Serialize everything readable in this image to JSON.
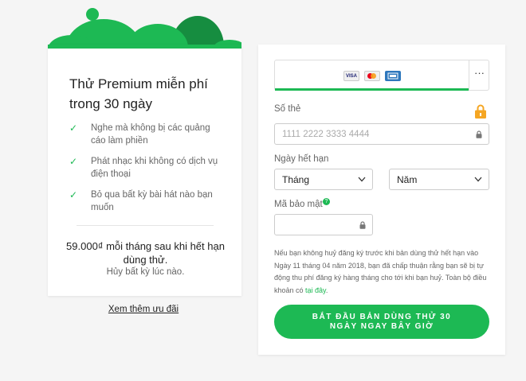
{
  "offer": {
    "title": "Thử Premium miễn phí trong 30 ngày",
    "features": [
      "Nghe mà không bị các quảng cáo làm phiền",
      "Phát nhạc khi không có dịch vụ điện thoại",
      "Bỏ qua bất kỳ bài hát nào bạn muốn"
    ],
    "check_glyph": "✓",
    "price_text": "59.000₫ mỗi tháng sau khi hết hạn dùng thử.",
    "cancel_text": "Hủy bất kỳ lúc nào.",
    "more_offers_link": "Xem thêm ưu đãi"
  },
  "payment": {
    "card_logos": [
      "VISA",
      "Mastercard",
      "AMEX"
    ],
    "more_options": "···",
    "card_number_label": "Số thẻ",
    "card_number_placeholder": "1111 2222 3333 4444",
    "expiry_label": "Ngày hết hạn",
    "month_select": "Tháng",
    "year_select": "Năm",
    "cvv_label": "Mã bảo mật",
    "help_glyph": "?",
    "notice_text": "Nếu bạn không huỷ đăng ký trước khi bản dùng thử hết hạn vào Ngày 11 tháng 04 năm 2018, bạn đã chấp thuận rằng bạn sẽ bị tự động thu phí đăng ký hàng tháng cho tới khi bạn huỷ. Toàn bộ điều khoản có ",
    "notice_link": "tại đây",
    "notice_end": ".",
    "submit_label": "BẮT ĐẦU BẢN DÙNG THỬ 30 NGÀY NGAY BÂY GIỜ"
  },
  "colors": {
    "brand_green": "#1db954",
    "dark_green": "#168d40",
    "lock_orange": "#f5a623"
  }
}
